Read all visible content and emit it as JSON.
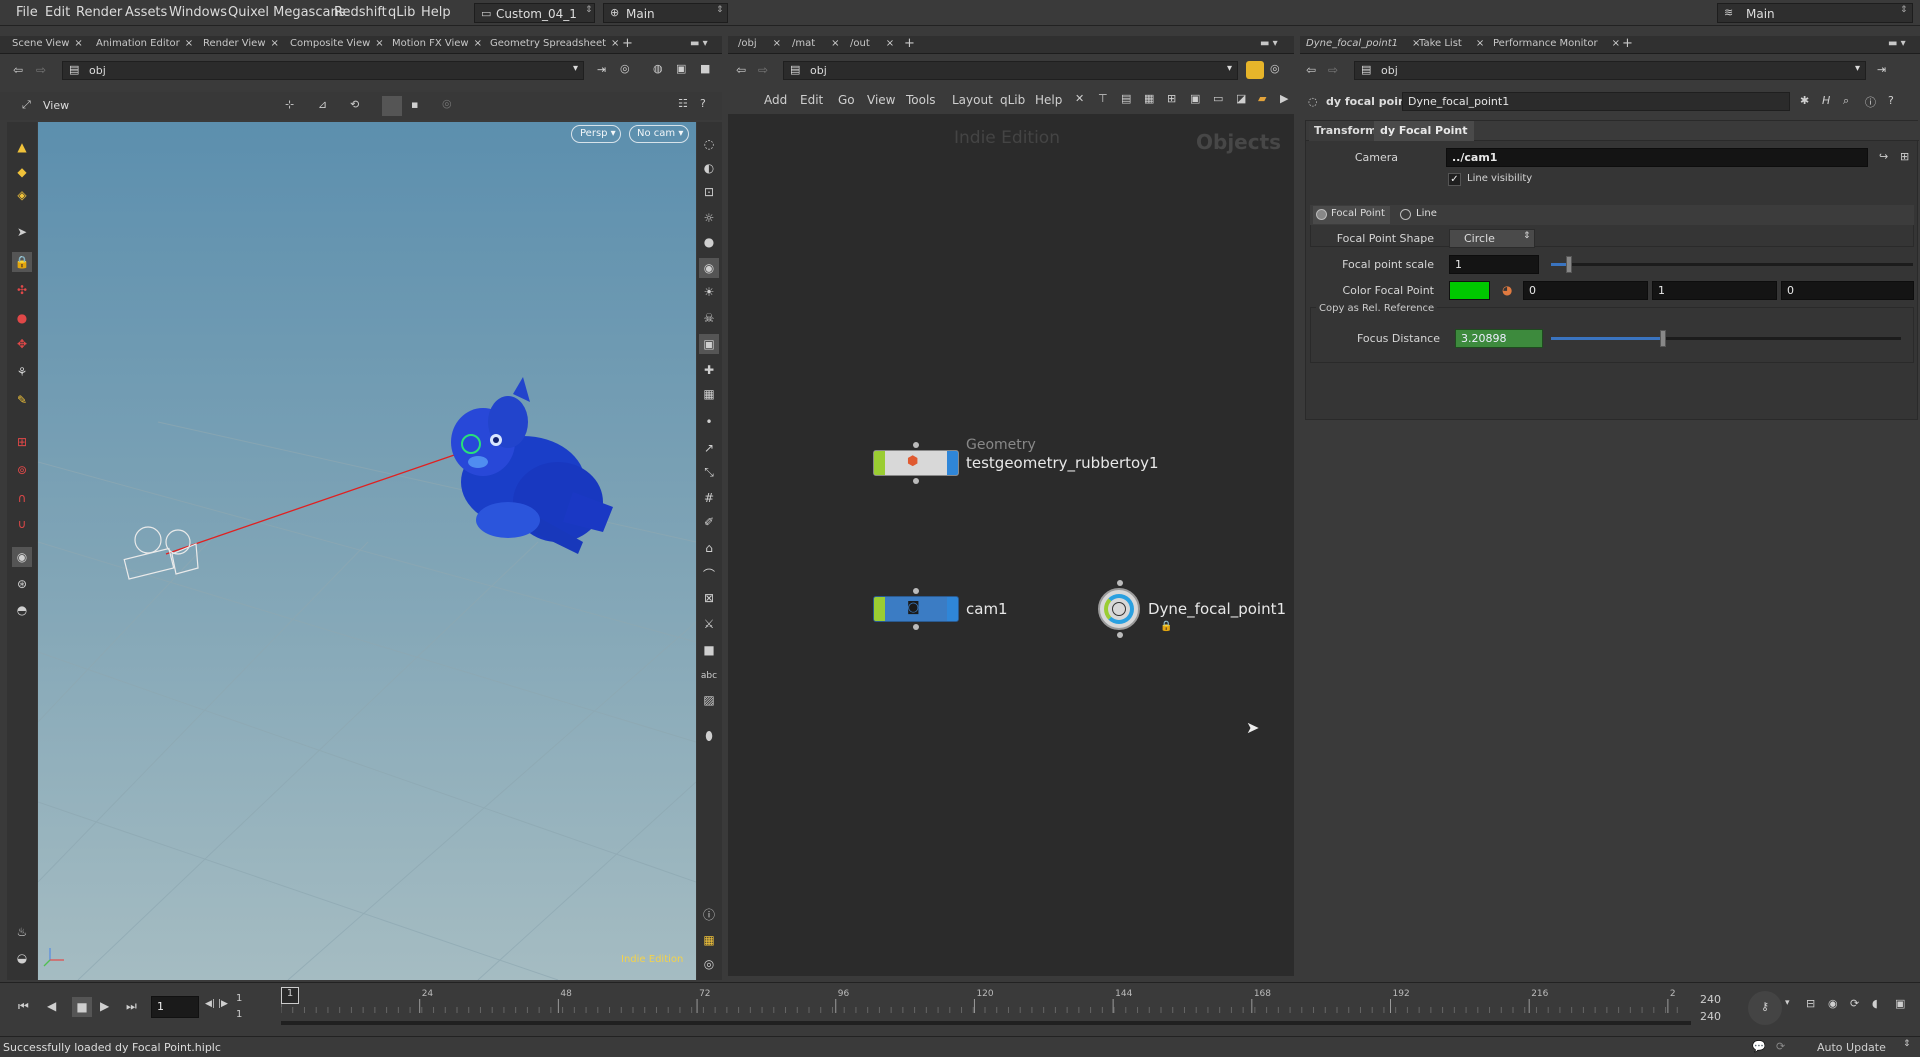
{
  "menu": {
    "items": [
      "File",
      "Edit",
      "Render",
      "Assets",
      "Windows",
      "Quixel Megascans",
      "Redshift",
      "qLib",
      "Help"
    ],
    "desktop": "Custom_04_1",
    "context": "Main",
    "right_desktop": "Main"
  },
  "left_pane": {
    "tabs": [
      "Scene View",
      "Animation Editor",
      "Render View",
      "Composite View",
      "Motion FX View",
      "Geometry Spreadsheet"
    ],
    "path": "obj",
    "view_label": "View",
    "persp_menu": "Persp",
    "cam_menu": "No cam",
    "watermark": "Indie Edition"
  },
  "network_pane": {
    "tabs": [
      "/obj",
      "/mat",
      "/out"
    ],
    "path": "obj",
    "menu": [
      "Add",
      "Edit",
      "Go",
      "View",
      "Tools",
      "Layout",
      "qLib",
      "Help"
    ],
    "watermark": "Indie Edition",
    "context_title": "Objects",
    "nodes": [
      {
        "type_label": "Geometry",
        "name": "testgeometry_rubbertoy1"
      },
      {
        "type_label": "",
        "name": "cam1"
      },
      {
        "type_label": "",
        "name": "Dyne_focal_point1"
      }
    ]
  },
  "param_pane": {
    "tabs": [
      "Dyne_focal_point1",
      "Take List",
      "Performance Monitor"
    ],
    "path": "obj",
    "node_type": "dy focal point",
    "node_name": "Dyne_focal_point1",
    "folder_tabs": [
      "Transform",
      "dy Focal Point"
    ],
    "camera_label": "Camera",
    "camera_value": "../cam1",
    "line_visibility": "Line visibility",
    "radio_focal": "Focal Point",
    "radio_line": "Line",
    "shape_label": "Focal Point Shape",
    "shape_value": "Circle",
    "scale_label": "Focal point scale",
    "scale_value": "1",
    "scale_fraction": 0.05,
    "color_label": "Color Focal Point",
    "color_hex": "#00c800",
    "color_r": "0",
    "color_g": "1",
    "color_b": "0",
    "copy_ref": "Copy as Rel. Reference",
    "focus_label": "Focus Distance",
    "focus_value": "3.20898",
    "focus_fraction": 0.32
  },
  "timeline": {
    "frame": "1",
    "start": "1",
    "start2": "1",
    "ticks": [
      "1",
      "24",
      "48",
      "72",
      "96",
      "120",
      "144",
      "168",
      "192",
      "216",
      "2"
    ],
    "end": "240",
    "end2": "240"
  },
  "status": {
    "message": "Successfully loaded dy Focal Point.hiplc",
    "auto_update": "Auto Update"
  },
  "colors": {
    "accent_blue": "#2f5fa8",
    "node_green": "#9acd32",
    "focus_green": "#3d8a3d"
  }
}
